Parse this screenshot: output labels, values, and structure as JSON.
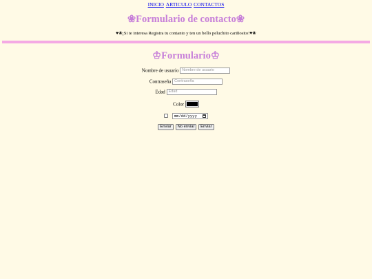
{
  "nav": {
    "links": [
      "INICIO",
      "ARTICULO",
      "CONTACTOS"
    ]
  },
  "header": {
    "title": "❀Formulario de contacto❀",
    "tagline": "♥❀¡Si te interesa Registra tu contanto y ten un bello peluchito cariñosito!♥❀"
  },
  "colors": {
    "background": "#fffae6",
    "title": "#c77fd9",
    "divider": "#f4a9e4",
    "link": "#0000ee",
    "selected_color": "#000000"
  },
  "form": {
    "title": "♔Formulario♔",
    "username": {
      "label": "Nombre de usuario",
      "placeholder": "Nombre de usuario"
    },
    "password": {
      "label": "Contraseña",
      "placeholder": "Contraseña"
    },
    "age": {
      "label": "Edad",
      "placeholder": "Edad"
    },
    "color": {
      "label": "Color"
    },
    "date": {
      "placeholder": "mm/dd/yyyy",
      "icon": "calendar-icon"
    },
    "buttons": [
      "Enviar",
      "No enviar",
      "Enviar"
    ]
  }
}
